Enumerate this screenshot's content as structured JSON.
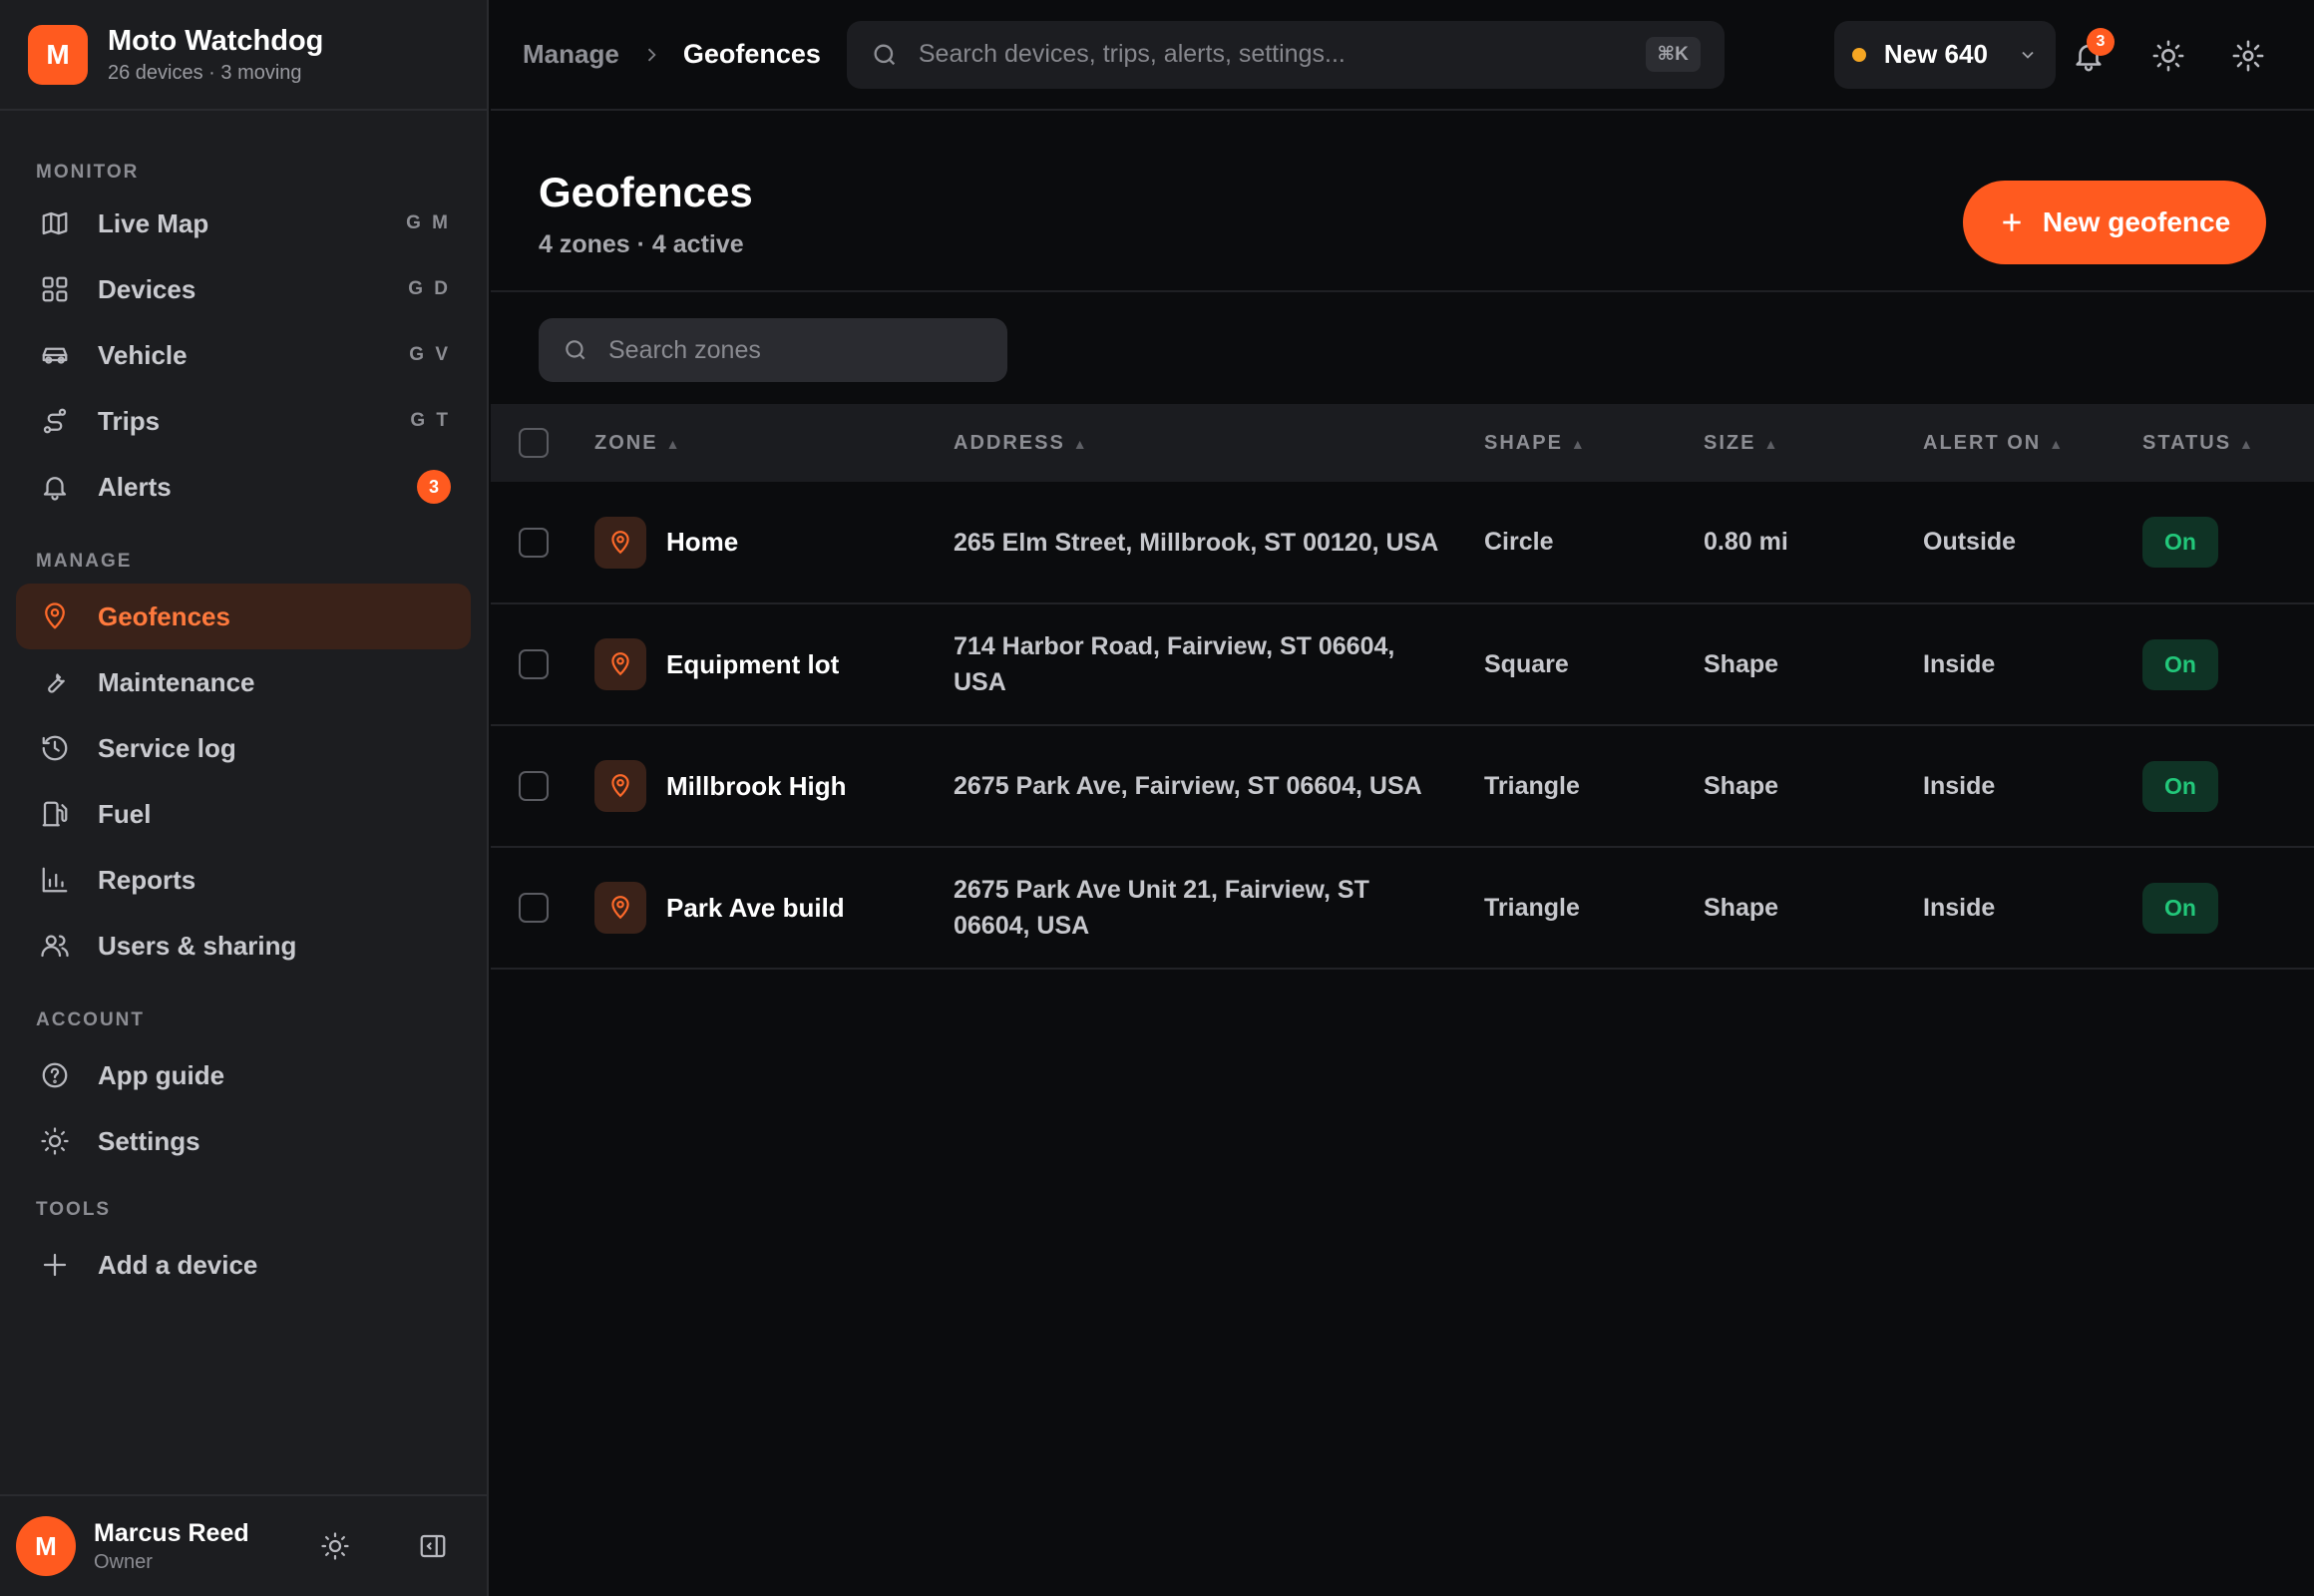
{
  "brand": {
    "logo_letter": "M",
    "name": "Moto Watchdog",
    "subtitle": "26 devices · 3 moving"
  },
  "sidebar": {
    "sections": [
      {
        "title": "MONITOR",
        "items": [
          {
            "label": "Live Map",
            "icon": "map-icon",
            "shortcut": "G M"
          },
          {
            "label": "Devices",
            "icon": "grid-icon",
            "shortcut": "G D"
          },
          {
            "label": "Vehicle",
            "icon": "car-icon",
            "shortcut": "G V"
          },
          {
            "label": "Trips",
            "icon": "route-icon",
            "shortcut": "G T"
          },
          {
            "label": "Alerts",
            "icon": "bell-icon",
            "badge": "3"
          }
        ]
      },
      {
        "title": "MANAGE",
        "items": [
          {
            "label": "Geofences",
            "icon": "pin-icon",
            "active": true
          },
          {
            "label": "Maintenance",
            "icon": "wrench-icon"
          },
          {
            "label": "Service log",
            "icon": "history-icon"
          },
          {
            "label": "Fuel",
            "icon": "fuel-icon"
          },
          {
            "label": "Reports",
            "icon": "chart-icon"
          },
          {
            "label": "Users & sharing",
            "icon": "users-icon"
          }
        ]
      },
      {
        "title": "ACCOUNT",
        "items": [
          {
            "label": "App guide",
            "icon": "help-icon"
          },
          {
            "label": "Settings",
            "icon": "sun-gear-icon"
          }
        ]
      },
      {
        "title": "TOOLS",
        "items": [
          {
            "label": "Add a device",
            "icon": "plus-icon"
          }
        ]
      }
    ],
    "user": {
      "initial": "M",
      "name": "Marcus Reed",
      "role": "Owner"
    }
  },
  "topbar": {
    "breadcrumb": [
      "Manage",
      "Geofences"
    ],
    "search_placeholder": "Search devices, trips, alerts, settings...",
    "search_shortcut": "⌘K",
    "device": {
      "name": "New 640",
      "status_color": "#f5a623"
    },
    "notifications_count": "3"
  },
  "page": {
    "title": "Geofences",
    "subtitle": "4 zones · 4 active",
    "new_button": "New geofence",
    "zone_search_placeholder": "Search zones"
  },
  "table": {
    "columns": [
      "ZONE",
      "ADDRESS",
      "SHAPE",
      "SIZE",
      "ALERT ON",
      "STATUS"
    ],
    "rows": [
      {
        "zone": "Home",
        "address": "265 Elm Street, Millbrook, ST 00120, USA",
        "shape": "Circle",
        "size": "0.80 mi",
        "alert_on": "Outside",
        "status": "On"
      },
      {
        "zone": "Equipment lot",
        "address": "714 Harbor Road, Fairview, ST 06604, USA",
        "shape": "Square",
        "size": "Shape",
        "alert_on": "Inside",
        "status": "On"
      },
      {
        "zone": "Millbrook High",
        "address": "2675 Park Ave, Fairview, ST 06604, USA",
        "shape": "Triangle",
        "size": "Shape",
        "alert_on": "Inside",
        "status": "On"
      },
      {
        "zone": "Park Ave build",
        "address": "2675 Park Ave Unit 21, Fairview, ST 06604, USA",
        "shape": "Triangle",
        "size": "Shape",
        "alert_on": "Inside",
        "status": "On"
      }
    ]
  },
  "colors": {
    "accent": "#ff5a1f",
    "status_on": "#22c77a",
    "background": "#0b0c0e",
    "sidebar": "#1c1d20"
  }
}
